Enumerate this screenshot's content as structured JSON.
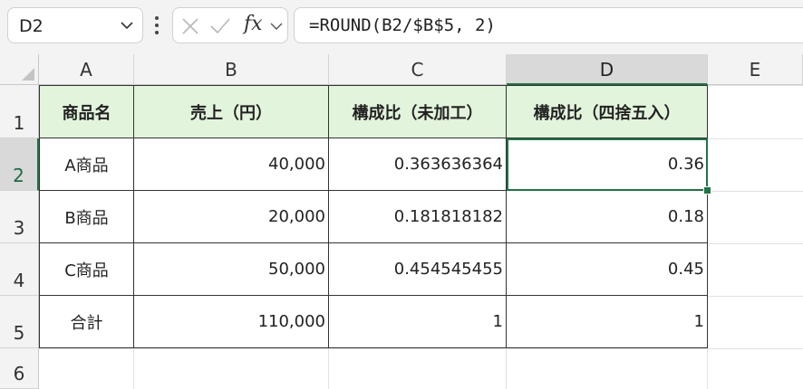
{
  "name_box": {
    "value": "D2"
  },
  "formula_bar": {
    "formula": "=ROUND(B2/$B$5, 2)",
    "fx_label": "fx"
  },
  "columns": [
    "A",
    "B",
    "C",
    "D",
    "E"
  ],
  "rows": [
    "1",
    "2",
    "3",
    "4",
    "5",
    "6"
  ],
  "table": {
    "headers": [
      "商品名",
      "売上（円）",
      "構成比（未加工）",
      "構成比（四捨五入）"
    ],
    "data": [
      [
        "A商品",
        "40,000",
        "0.363636364",
        "0.36"
      ],
      [
        "B商品",
        "20,000",
        "0.181818182",
        "0.18"
      ],
      [
        "C商品",
        "50,000",
        "0.454545455",
        "0.45"
      ],
      [
        "合計",
        "110,000",
        "1",
        "1"
      ]
    ]
  },
  "colors": {
    "accent": "#217346",
    "header_fill": "#e2f4dc"
  }
}
